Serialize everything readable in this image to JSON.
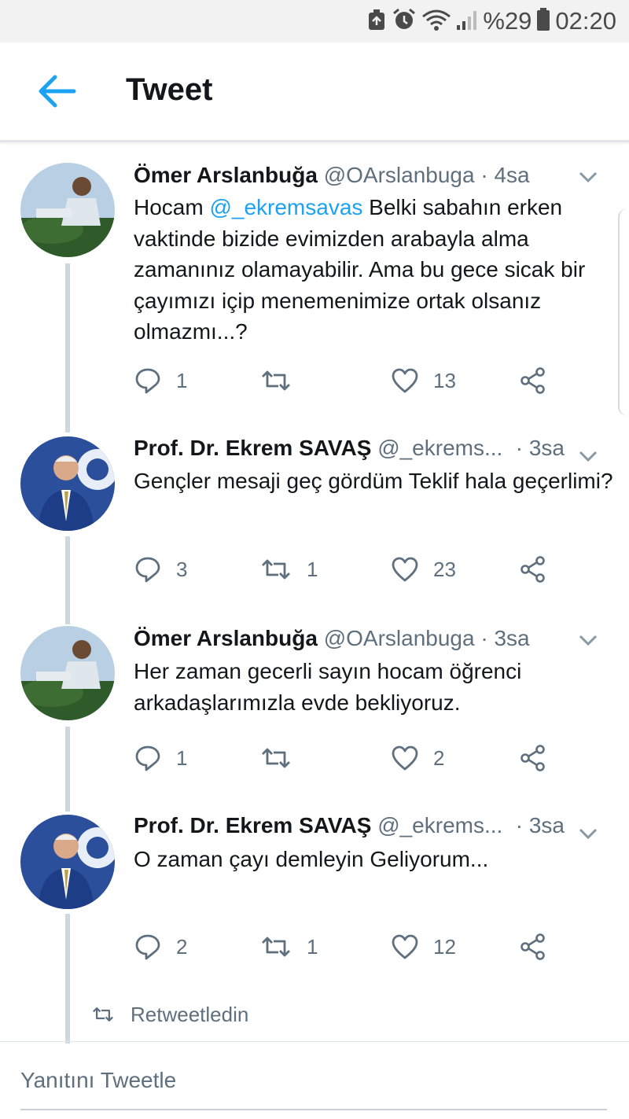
{
  "status_bar": {
    "battery": "%29",
    "time": "02:20",
    "icons": [
      "recycle-icon",
      "alarm-icon",
      "wifi-icon",
      "signal-icon",
      "battery-icon"
    ]
  },
  "header": {
    "title": "Tweet",
    "back_icon": "arrow-left-icon"
  },
  "tweets": [
    {
      "name": "Ömer Arslanbuğa",
      "handle": "@OArslanbuga",
      "separator": "·",
      "time": "4sa",
      "body_pre": "Hocam ",
      "mention": "@_ekremsavas",
      "body_post": " Belki sabahın erken vaktinde bizide evimizden arabayla alma zamanınız olamayabilir. Ama bu gece sicak bir çayımızı içip menemenimize ortak olsanız olmazmı...?",
      "replies": "1",
      "retweets": "",
      "likes": "13"
    },
    {
      "name": "Prof. Dr. Ekrem SAVAŞ",
      "handle": "@_ekrems...",
      "separator": "·",
      "time": "3sa",
      "body": "Gençler mesaji geç gördüm Teklif hala geçerlimi?",
      "replies": "3",
      "retweets": "1",
      "likes": "23"
    },
    {
      "name": "Ömer Arslanbuğa",
      "handle": "@OArslanbuga",
      "separator": "·",
      "time": "3sa",
      "body": "Her zaman gecerli sayın hocam öğrenci arkadaşlarımızla evde bekliyoruz.",
      "replies": "1",
      "retweets": "",
      "likes": "2"
    },
    {
      "name": "Prof. Dr. Ekrem SAVAŞ",
      "handle": "@_ekrems...",
      "separator": "·",
      "time": "3sa",
      "body": "O zaman çayı demleyin Geliyorum...",
      "replies": "2",
      "retweets": "1",
      "likes": "12"
    }
  ],
  "retweeted_label": "Retweetledin",
  "reply_placeholder": "Yanıtını Tweetle",
  "colors": {
    "accent": "#1da1f2",
    "secondary_text": "#5f6f7d",
    "thread_line": "#cfd8de"
  }
}
